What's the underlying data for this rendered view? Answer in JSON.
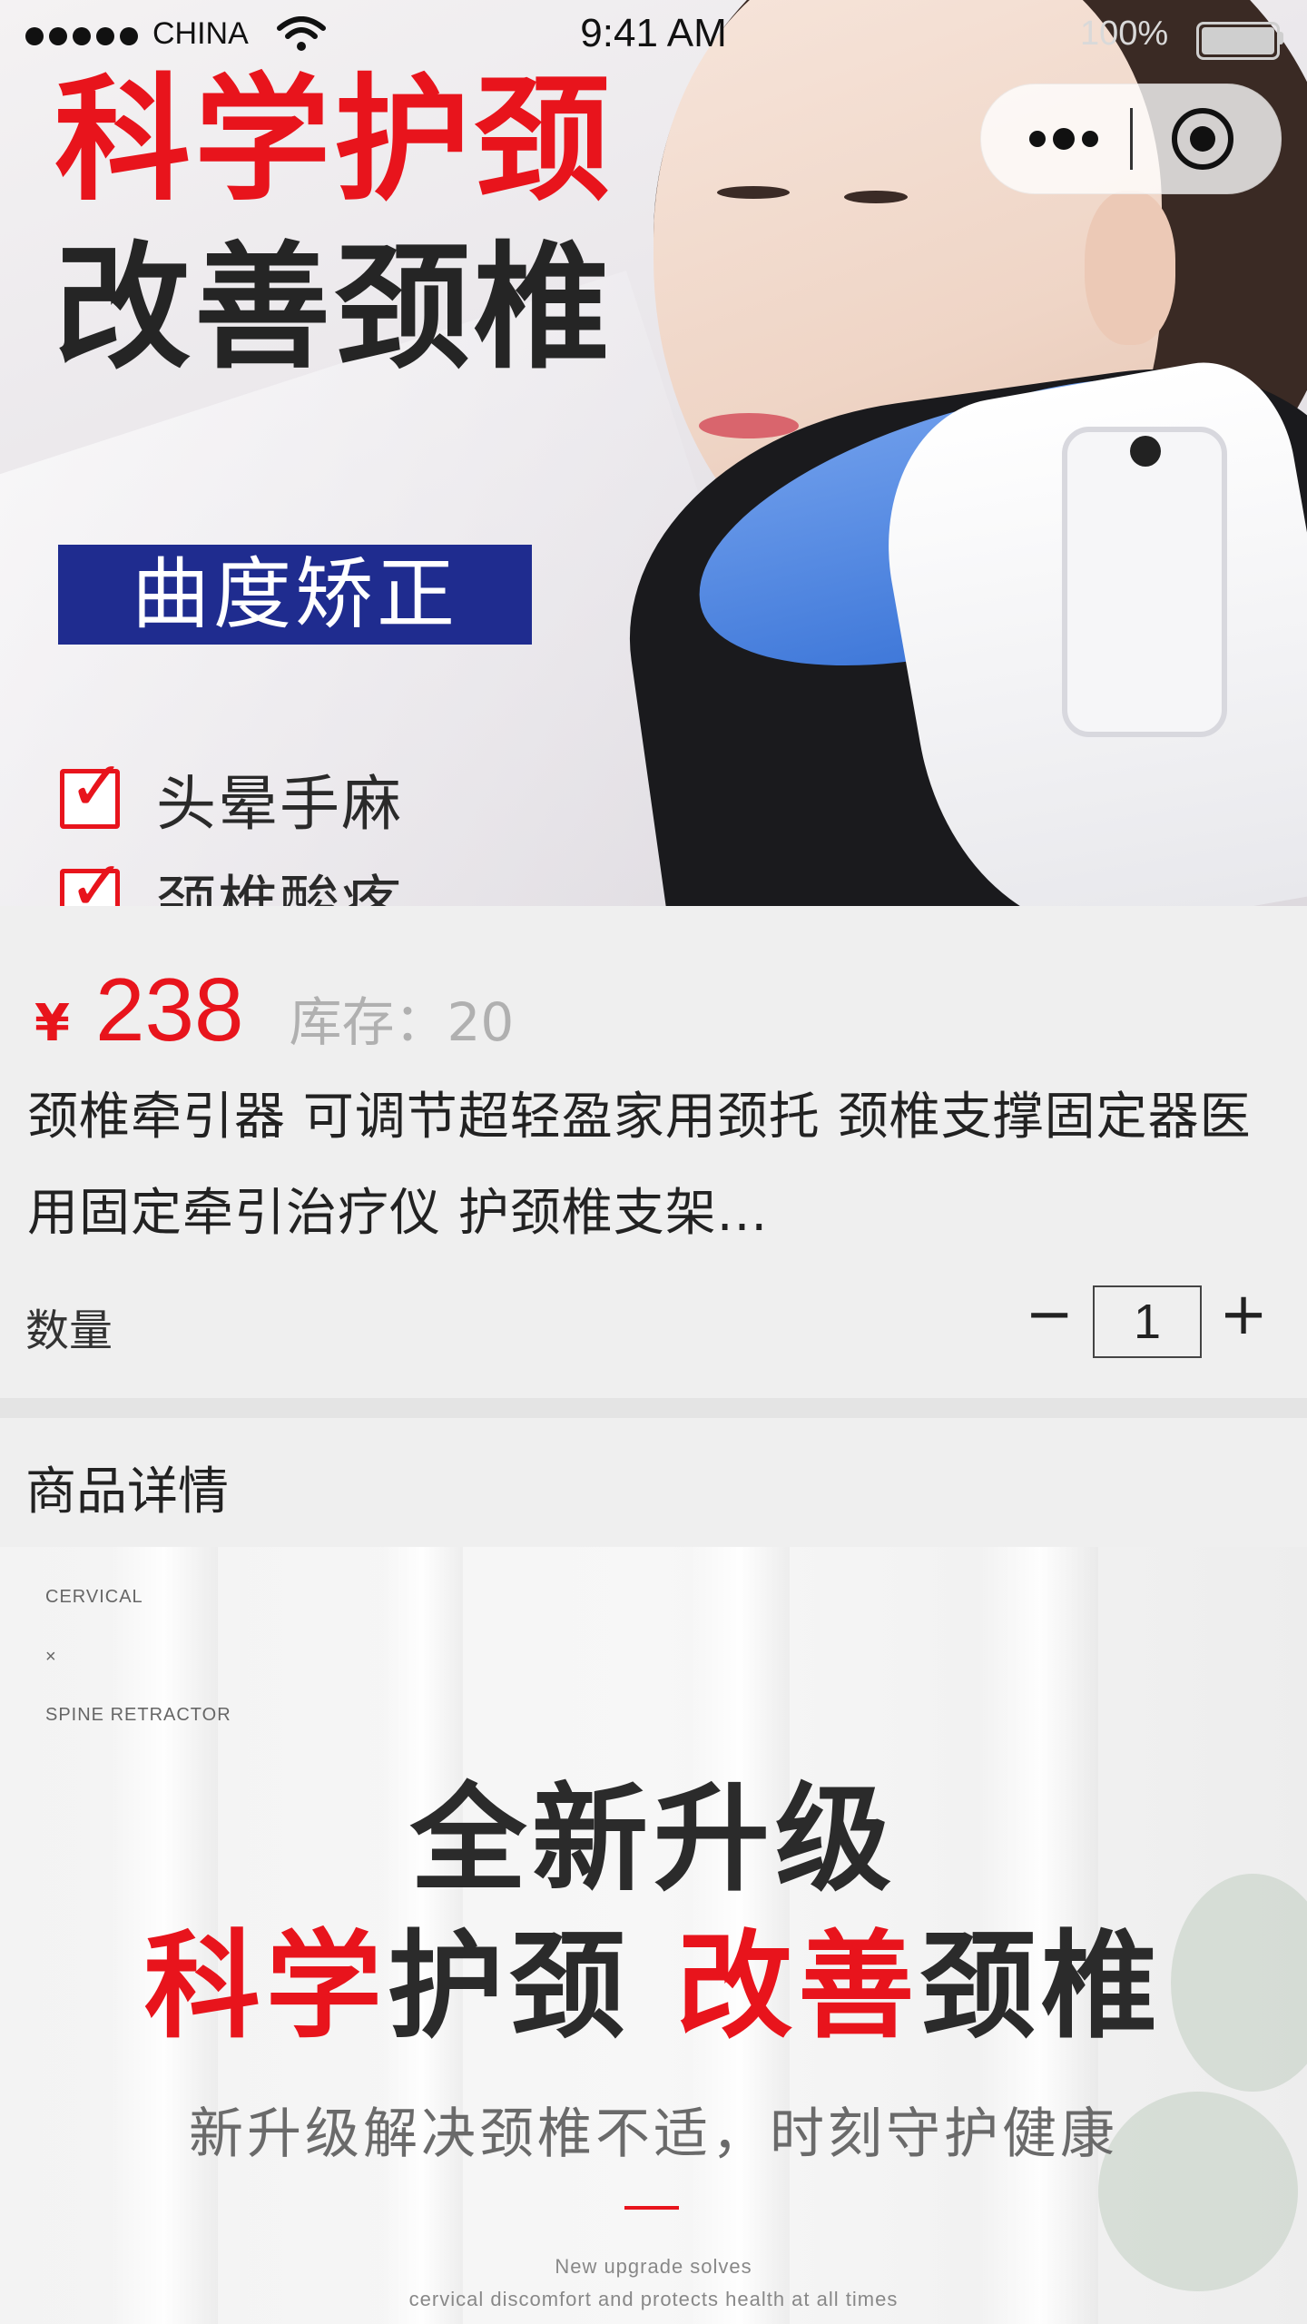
{
  "status_bar": {
    "carrier": "CHINA",
    "time": "9:41 AM",
    "battery": "100%"
  },
  "hero": {
    "headline_red": "科学护颈",
    "headline_dark": "改善颈椎",
    "badge": "曲度矫正",
    "checks": [
      "头晕手麻",
      "颈椎酸疼"
    ]
  },
  "product": {
    "currency": "¥",
    "price": "238",
    "stock": "库存：20",
    "title": "颈椎牵引器 可调节超轻盈家用颈托 颈椎支撑固定器医用固定牵引治疗仪 护颈椎支架..."
  },
  "quantity": {
    "label": "数量",
    "minus": "−",
    "value": "1",
    "plus": "+"
  },
  "details": {
    "header": "商品详情",
    "tag_1": "CERVICAL",
    "tag_x": "×",
    "tag_2": "SPINE RETRACTOR",
    "heading_line1": "全新升级",
    "heading_red_1": "科学",
    "heading_dark_1": "护颈 ",
    "heading_red_2": "改善",
    "heading_dark_2": "颈椎",
    "subtitle": "新升级解决颈椎不适，时刻守护健康",
    "en_line1": "New upgrade solves",
    "en_line2": "cervical discomfort and protects health at all times"
  },
  "colors": {
    "accent_red": "#e8141c",
    "badge_blue": "#1f2c8f"
  }
}
